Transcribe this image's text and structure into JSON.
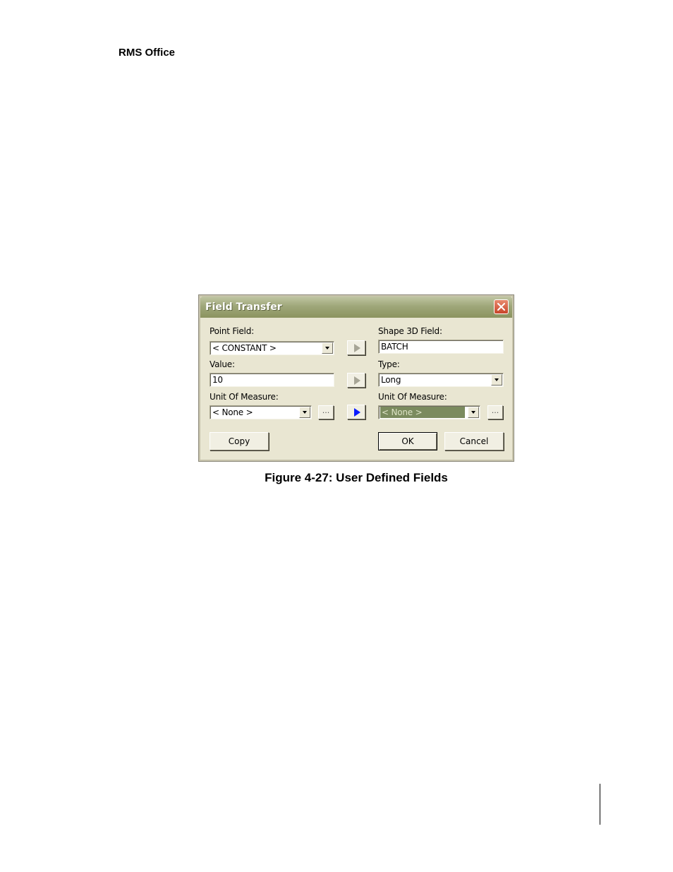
{
  "page": {
    "running_header": "RMS Office",
    "figure_caption": "Figure 4-27: User Defined Fields"
  },
  "dialog": {
    "title": "Field Transfer",
    "left": {
      "point_field_label": "Point Field:",
      "point_field_value": "< CONSTANT >",
      "value_label": "Value:",
      "value_value": "10",
      "unit_label": "Unit Of Measure:",
      "unit_value": "< None >",
      "browse_label": "..."
    },
    "right": {
      "shape_field_label": "Shape 3D Field:",
      "shape_field_value": "BATCH",
      "type_label": "Type:",
      "type_value": "Long",
      "unit_label": "Unit Of Measure:",
      "unit_value": "< None >",
      "browse_label": "..."
    },
    "buttons": {
      "copy": "Copy",
      "ok": "OK",
      "cancel": "Cancel"
    },
    "icons": {
      "close": "close-icon",
      "transfer_arrow": "triangle-right-icon",
      "dropdown": "chevron-down-icon"
    },
    "colors": {
      "title_bar": "#9fa77a",
      "close_button": "#c8452a",
      "active_arrow": "#0a1bff",
      "selection": "#7b8b5e"
    }
  }
}
